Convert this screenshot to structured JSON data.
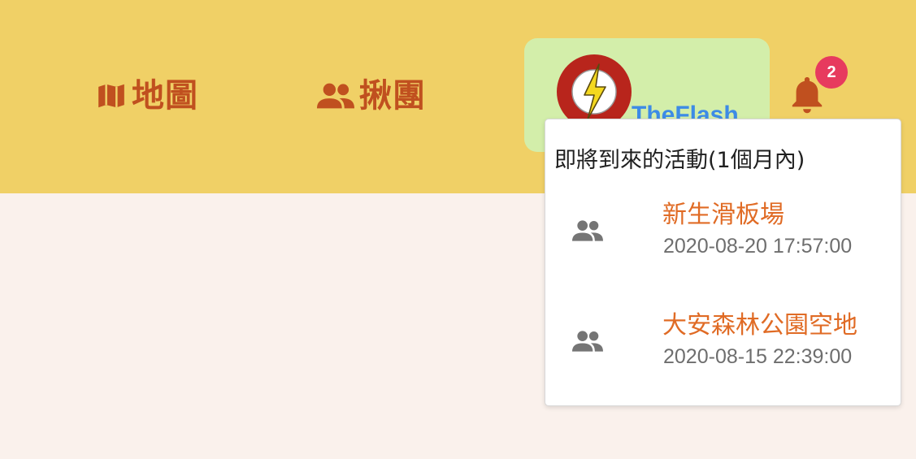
{
  "nav": {
    "map": {
      "label": "地圖",
      "icon": "map-icon"
    },
    "groups": {
      "label": "揪團",
      "icon": "people-icon"
    }
  },
  "profile": {
    "username": "TheFlash",
    "avatar_icon": "flash-logo-avatar"
  },
  "notifications": {
    "icon": "bell-icon",
    "badge_count": "2",
    "dropdown": {
      "title": "即將到來的活動(1個月內)",
      "events": [
        {
          "icon": "people-icon",
          "name": "新生滑板場",
          "time": "2020-08-20 17:57:00"
        },
        {
          "icon": "people-icon",
          "name": "大安森林公園空地",
          "time": "2020-08-15 22:39:00"
        }
      ]
    }
  },
  "colors": {
    "topbar_bg": "#f0d066",
    "page_bg": "#faf1ec",
    "nav_text": "#c0501f",
    "profile_bg": "#d3eeaa",
    "username": "#3d8be6",
    "badge": "#e73a5e",
    "event_name": "#e06b25",
    "event_time": "#6e6e6e"
  }
}
